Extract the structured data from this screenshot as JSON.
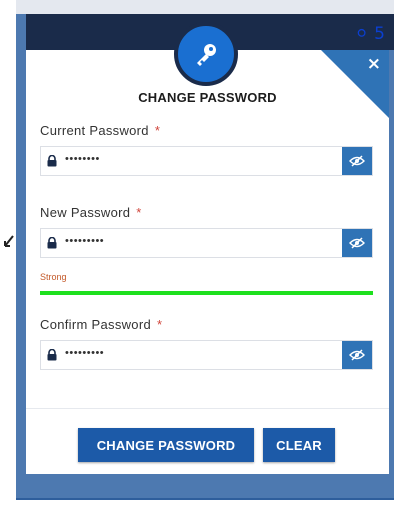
{
  "header": {
    "badge": "⚪ 5"
  },
  "dialog": {
    "title": "CHANGE PASSWORD",
    "close_label": "×",
    "fields": [
      {
        "label": "Current Password",
        "required_mark": "*",
        "value": "••••••••"
      },
      {
        "label": "New Password",
        "required_mark": "*",
        "value": "•••••••••"
      },
      {
        "label": "Confirm Password",
        "required_mark": "*",
        "value": "•••••••••"
      }
    ],
    "strength": {
      "label": "Strong",
      "level": 1.0,
      "color": "#1ee01e"
    },
    "buttons": {
      "change": "CHANGE PASSWORD",
      "clear": "CLEAR"
    }
  },
  "colors": {
    "accent": "#1c5aa8",
    "eye_button": "#2f73b6",
    "header": "#1a2b4a",
    "required": "#d0443a"
  },
  "icons": [
    "key-icon",
    "close-icon",
    "lock-icon",
    "eye-slash-icon"
  ]
}
